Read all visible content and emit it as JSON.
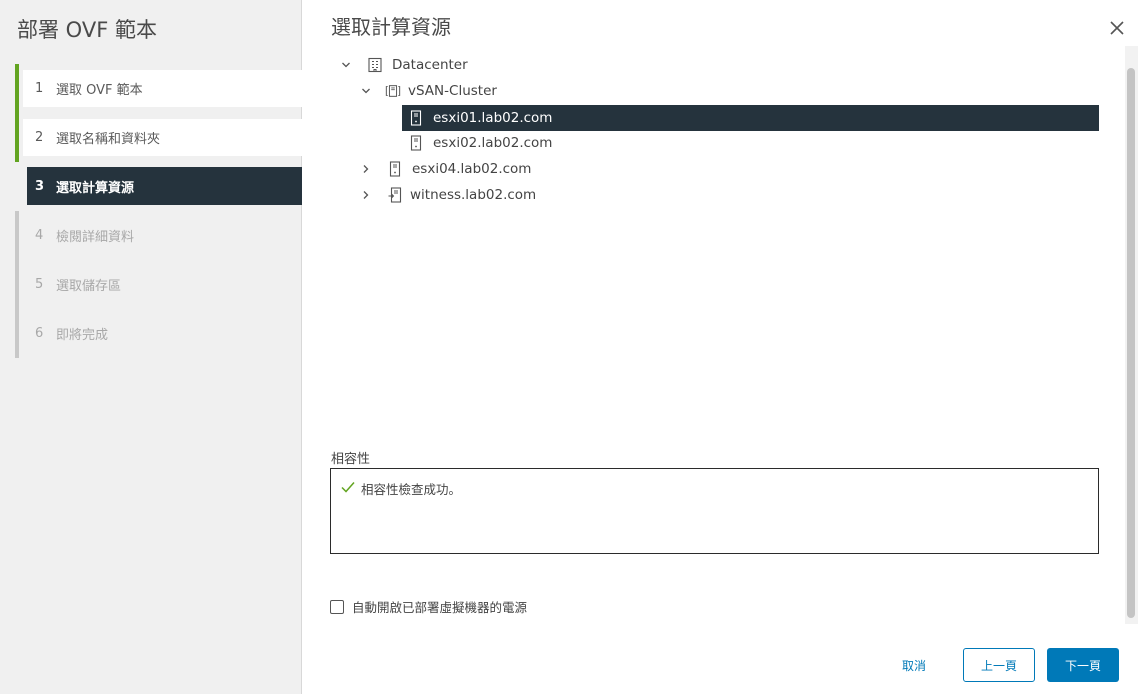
{
  "wizard": {
    "title": "部署 OVF 範本",
    "steps": [
      {
        "num": "1",
        "label": "選取 OVF 範本",
        "state": "done"
      },
      {
        "num": "2",
        "label": "選取名稱和資料夾",
        "state": "done"
      },
      {
        "num": "3",
        "label": "選取計算資源",
        "state": "active"
      },
      {
        "num": "4",
        "label": "檢閱詳細資料",
        "state": "future"
      },
      {
        "num": "5",
        "label": "選取儲存區",
        "state": "future"
      },
      {
        "num": "6",
        "label": "即將完成",
        "state": "future"
      }
    ]
  },
  "page": {
    "title": "選取計算資源",
    "close_icon": "close-icon"
  },
  "tree": [
    {
      "label": "Datacenter",
      "icon": "datacenter-icon",
      "expanded": true
    },
    {
      "label": "vSAN-Cluster",
      "icon": "cluster-icon",
      "expanded": true
    },
    {
      "label": "esxi01.lab02.com",
      "icon": "host-icon",
      "selected": true
    },
    {
      "label": "esxi02.lab02.com",
      "icon": "host-icon"
    },
    {
      "label": "esxi04.lab02.com",
      "icon": "host-icon",
      "expanded": false
    },
    {
      "label": "witness.lab02.com",
      "icon": "witness-host-icon",
      "expanded": false
    }
  ],
  "compatibility": {
    "label": "相容性",
    "message": "相容性檢查成功。",
    "status_color": "#62a420"
  },
  "power_on": {
    "label": "自動開啟已部署虛擬機器的電源",
    "checked": false
  },
  "footer": {
    "cancel": "取消",
    "back": "上一頁",
    "next": "下一頁"
  },
  "colors": {
    "accent": "#0079b8",
    "selected_bg": "#25333d",
    "done_bar": "#62a420"
  }
}
